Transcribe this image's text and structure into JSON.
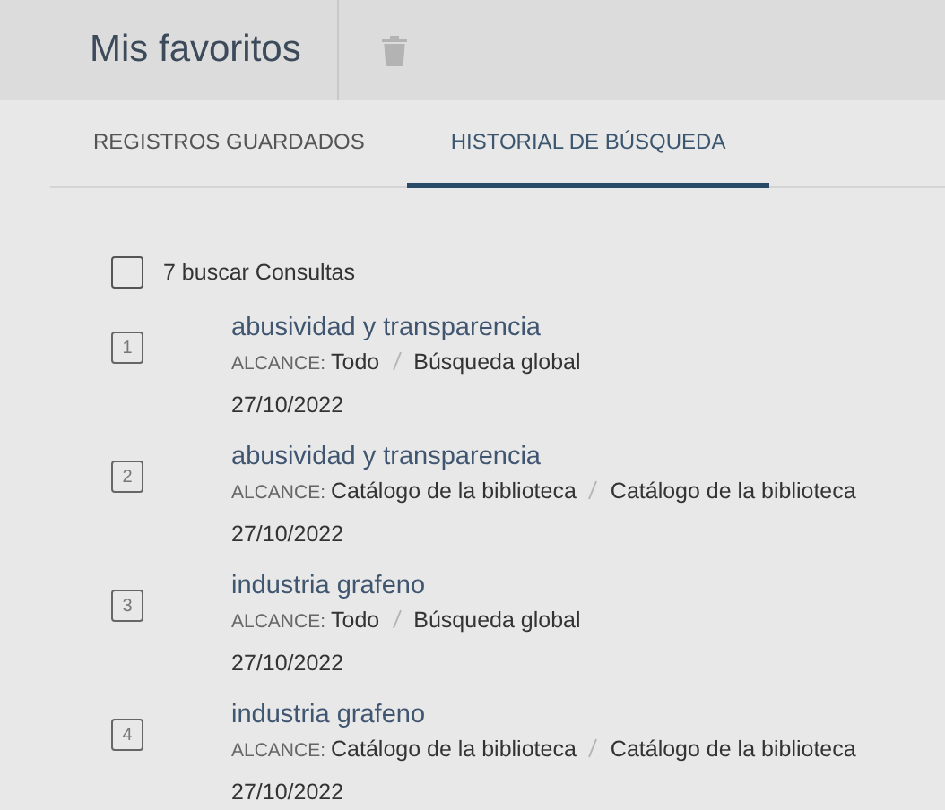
{
  "header": {
    "title": "Mis favoritos"
  },
  "tabs": [
    {
      "label": "REGISTROS GUARDADOS",
      "selected": false
    },
    {
      "label": "HISTORIAL DE BÚSQUEDA",
      "selected": true
    }
  ],
  "select_all": {
    "checked": false,
    "label": "7 buscar Consultas"
  },
  "queries": [
    {
      "number": "1",
      "query": "abusividad y transparencia",
      "scope_label": "ALCANCE:",
      "scope": "Todo",
      "source": "Búsqueda global",
      "date": "27/10/2022"
    },
    {
      "number": "2",
      "query": "abusividad y transparencia",
      "scope_label": "ALCANCE:",
      "scope": "Catálogo de la biblioteca",
      "source": "Catálogo de la biblioteca",
      "date": "27/10/2022"
    },
    {
      "number": "3",
      "query": "industria grafeno",
      "scope_label": "ALCANCE:",
      "scope": "Todo",
      "source": "Búsqueda global",
      "date": "27/10/2022"
    },
    {
      "number": "4",
      "query": "industria grafeno",
      "scope_label": "ALCANCE:",
      "scope": "Catálogo de la biblioteca",
      "source": "Catálogo de la biblioteca",
      "date": "27/10/2022"
    }
  ]
}
